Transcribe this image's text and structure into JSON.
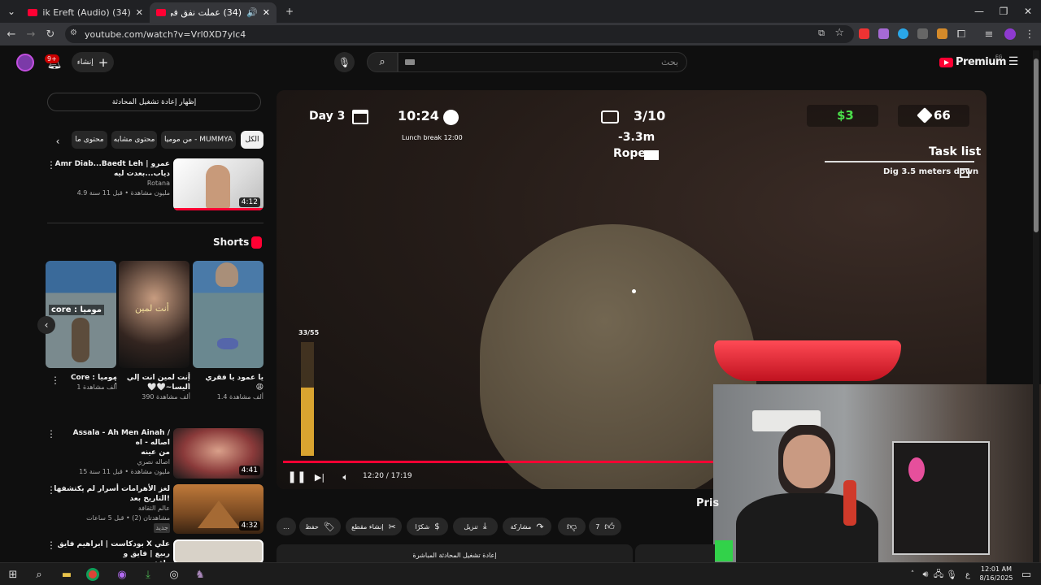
{
  "browser": {
    "tabs": [
      {
        "title": "(34) Elissa - Adik Ereft (Audio) / اليسا",
        "active": false
      },
      {
        "title": "(34) عملت نفق في سجن مفا",
        "active": true
      }
    ],
    "url": "youtube.com/watch?v=Vrl0XD7ylc4",
    "new_tab": "+",
    "win_min": "—",
    "win_max": "❐",
    "win_close": "✕"
  },
  "header": {
    "notif_count": "9+",
    "create_label": "إنشاء",
    "search_placeholder": "بحث",
    "logo_text": "Premium",
    "logo_region": "EG"
  },
  "chat_replay_label": "إظهار إعادة تشغيل المحادثة",
  "chips": [
    "الكل",
    "من موميا - MUMMYA",
    "محتوى مشابه",
    "محتوى ما"
  ],
  "related_top": {
    "title1": "Amr Diab...Baedt Leh | عمرو",
    "title2": "دياب...بعدت ليه",
    "channel": "Rotana",
    "meta": "4.9 مليون مشاهدة • قبل 11 سنة",
    "duration": "4:12"
  },
  "shorts": {
    "heading": "Shorts",
    "items": [
      {
        "title": "يا عمود يا فقري",
        "title2": "😩",
        "views": "1.4 ألف مشاهدة"
      },
      {
        "title": "أنت لمين انت إلي",
        "title2": "🤍🤍~الیسا",
        "views": "390 ألف مشاهدة",
        "thumb_text": "أنت لمين"
      },
      {
        "title": "Core : موميا",
        "title2": "",
        "views": "1 ألف مشاهدة",
        "thumb_text": "core : موميا"
      }
    ]
  },
  "related": [
    {
      "title1": "Assala - Ah Men Ainah / اصاله - اه",
      "title2": "من عينه",
      "channel": "اصاله نصري",
      "meta": "15 مليون مشاهدة • قبل 11 سنة",
      "duration": "4:41"
    },
    {
      "title1": "لغز الأهرامات أسرار لم يكتشفها التاريخ بعد!",
      "title2": "عالم الثقافة",
      "channel": "",
      "meta": "مشاهدتان (2) • قبل 5 ساعات",
      "badge": "جديد",
      "duration": "4:32"
    },
    {
      "title1": "بودكاست | ابراهيم فايق X علي ربيع | فايق و",
      "title2": "رافق",
      "channel": "",
      "meta": "",
      "duration": ""
    }
  ],
  "player": {
    "day": "Day 3",
    "time": "10:24",
    "lunch": "Lunch break 12:00",
    "count": "3/10",
    "depth": "-3.3m",
    "item": "Rope",
    "money": "$3",
    "gems": "66",
    "task_title": "Task list",
    "task_item": "Dig 3.5 meters down",
    "stamina": "33/55",
    "stamina_fraction": 0.6,
    "time_display": "12:20 / 17:19",
    "progress_fraction": 0.712
  },
  "video_title_fragment": "Pris",
  "actions": {
    "likes": "7",
    "share": "مشاركة",
    "download": "تنزيل",
    "thanks": "شكرًا",
    "clip": "إنشاء مقطع",
    "save": "حفظ",
    "more": "…"
  },
  "chat_replay_bottom": "إعادة تشغيل المحادثة المباشرة",
  "taskbar": {
    "time": "12:01 AM",
    "date": "8/16/2025",
    "lang": "ع"
  },
  "colors": {
    "accent": "#ff0033",
    "bg": "#0f0f0f",
    "chip": "#272727"
  }
}
